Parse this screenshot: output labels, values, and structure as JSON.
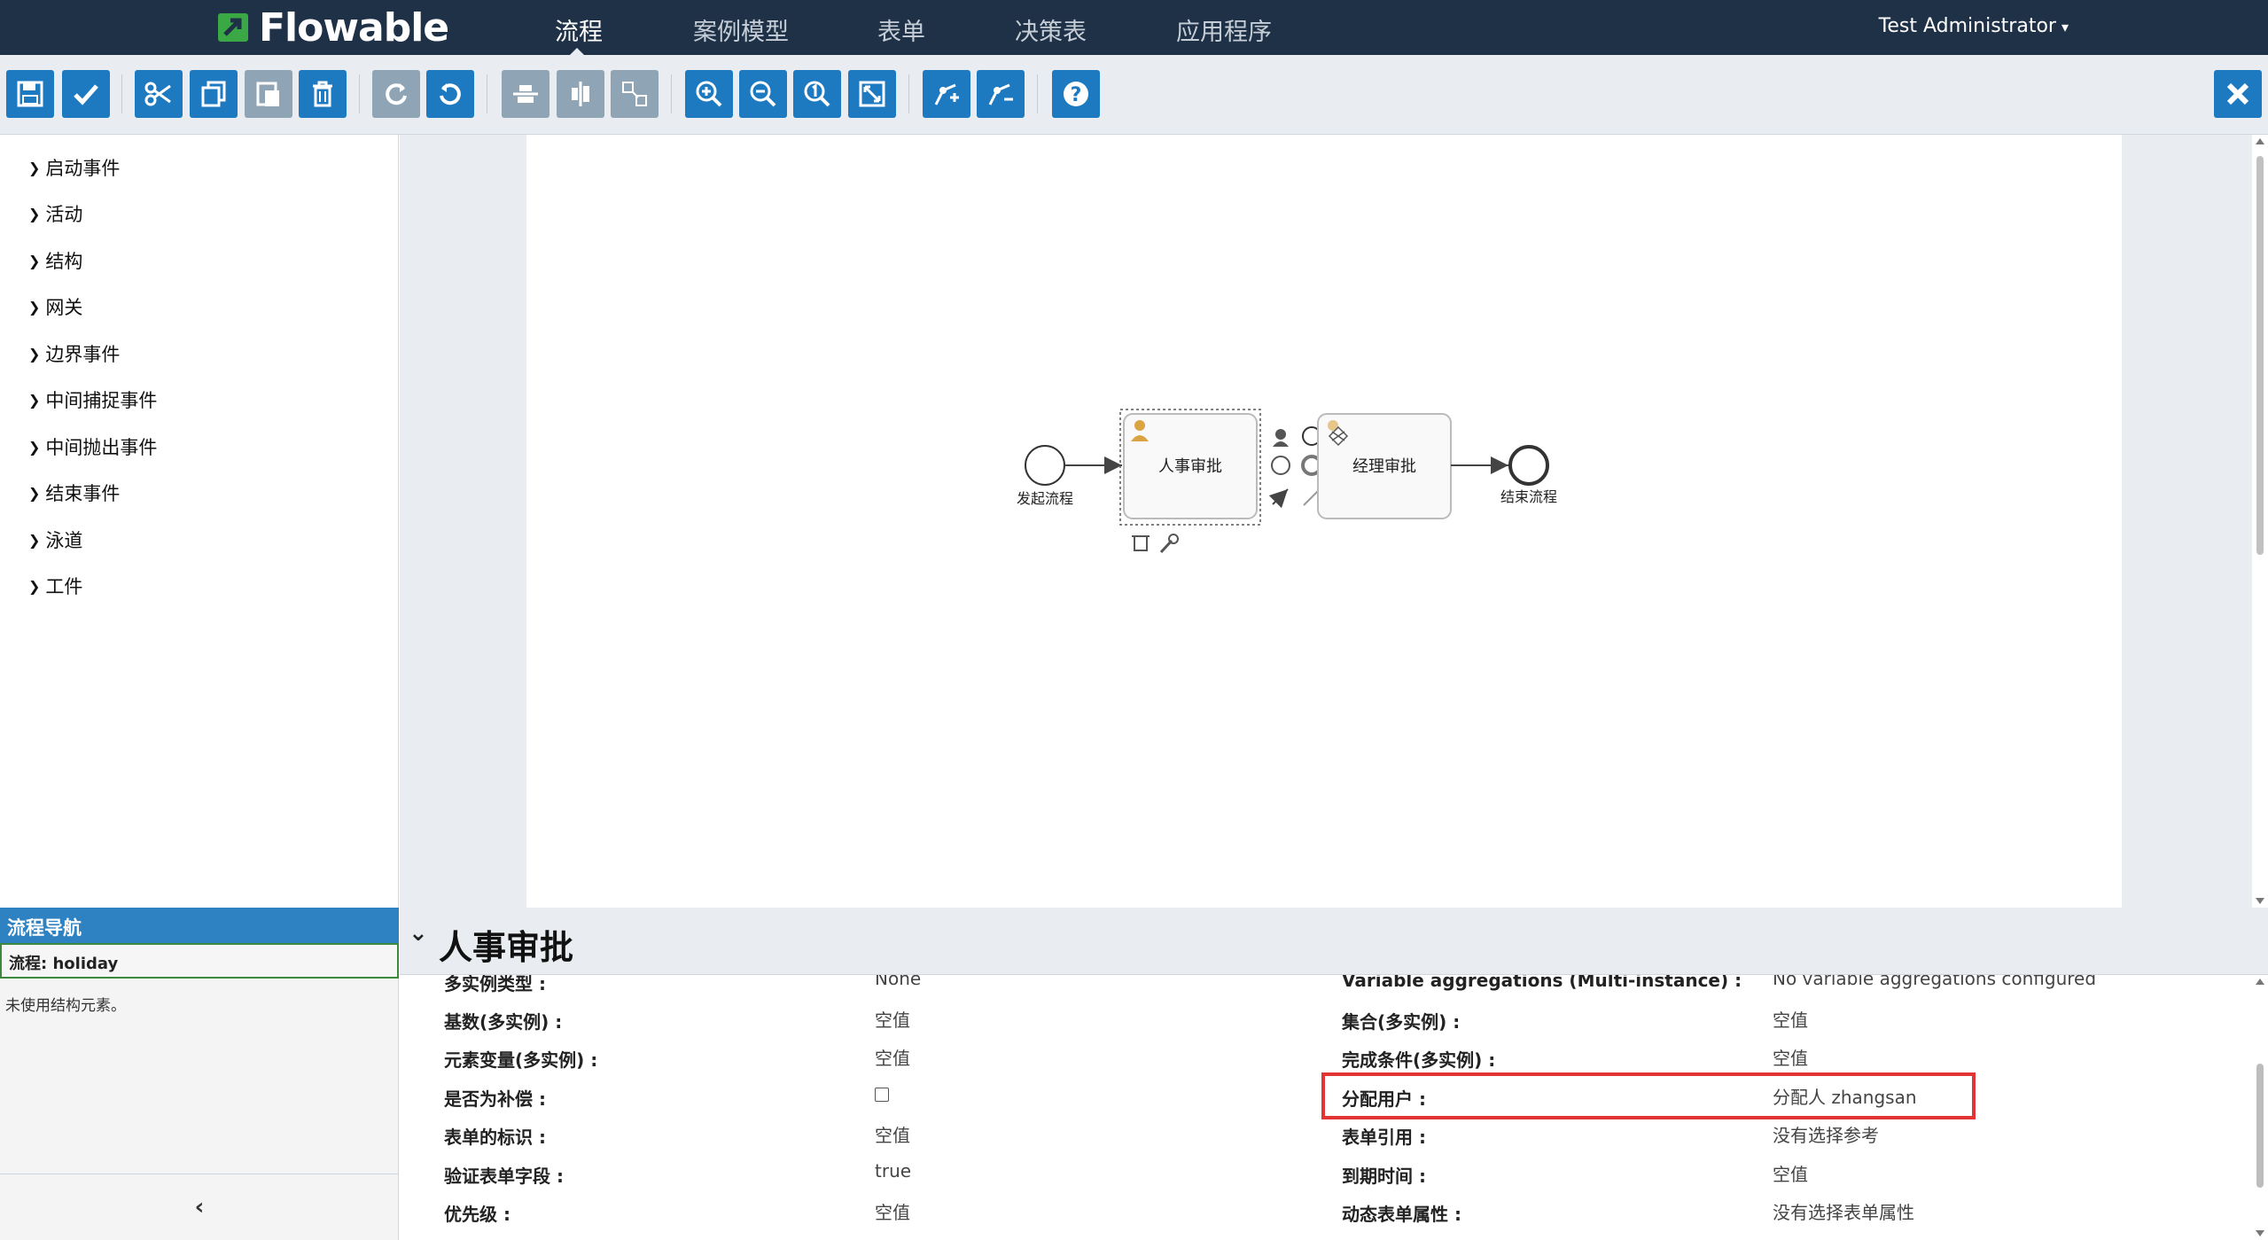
{
  "app": {
    "logo_text": "Flowable",
    "nav": [
      "流程",
      "案例模型",
      "表单",
      "决策表",
      "应用程序"
    ],
    "active_nav": "流程",
    "user": "Test Administrator"
  },
  "toolbar": {
    "buttons": [
      {
        "name": "save-button",
        "icon": "save-icon",
        "enabled": true
      },
      {
        "name": "validate-button",
        "icon": "check-icon",
        "enabled": true
      },
      {
        "name": "cut-button",
        "icon": "scissors-icon",
        "enabled": true
      },
      {
        "name": "copy-button",
        "icon": "copy-icon",
        "enabled": true
      },
      {
        "name": "paste-button",
        "icon": "paste-icon",
        "enabled": false
      },
      {
        "name": "delete-button",
        "icon": "trash-icon",
        "enabled": true
      },
      {
        "name": "redo-button",
        "icon": "redo-icon",
        "enabled": false
      },
      {
        "name": "undo-button",
        "icon": "undo-icon",
        "enabled": true
      },
      {
        "name": "align-horizontal-button",
        "icon": "align-horizontal-icon",
        "enabled": false
      },
      {
        "name": "align-vertical-button",
        "icon": "align-vertical-icon",
        "enabled": false
      },
      {
        "name": "same-size-button",
        "icon": "same-size-icon",
        "enabled": false
      },
      {
        "name": "zoom-in-button",
        "icon": "zoom-in-icon",
        "enabled": true
      },
      {
        "name": "zoom-out-button",
        "icon": "zoom-out-icon",
        "enabled": true
      },
      {
        "name": "zoom-actual-button",
        "icon": "zoom-actual-icon",
        "enabled": true
      },
      {
        "name": "zoom-fit-button",
        "icon": "fit-screen-icon",
        "enabled": true
      },
      {
        "name": "add-bendpoint-button",
        "icon": "add-bendpoint-icon",
        "enabled": true
      },
      {
        "name": "remove-bendpoint-button",
        "icon": "remove-bendpoint-icon",
        "enabled": true
      },
      {
        "name": "help-button",
        "icon": "help-icon",
        "enabled": true
      },
      {
        "name": "close-button",
        "icon": "close-icon",
        "enabled": true
      }
    ]
  },
  "palette": {
    "groups": [
      "启动事件",
      "活动",
      "结构",
      "网关",
      "边界事件",
      "中间捕捉事件",
      "中间抛出事件",
      "结束事件",
      "泳道",
      "工件"
    ]
  },
  "diagram": {
    "start_label": "发起流程",
    "task1_label": "人事审批",
    "task2_label": "经理审批",
    "end_label": "结束流程"
  },
  "navigator": {
    "title": "流程导航",
    "process": "流程: holiday",
    "note": "未使用结构元素。"
  },
  "properties": {
    "title": "人事审批",
    "left": [
      {
        "label": "多实例类型 :",
        "value": "None"
      },
      {
        "label": "基数(多实例) :",
        "value": "空值"
      },
      {
        "label": "元素变量(多实例) :",
        "value": "空值"
      },
      {
        "label": "是否为补偿 :",
        "value": ""
      },
      {
        "label": "表单的标识 :",
        "value": "空值"
      },
      {
        "label": "验证表单字段 :",
        "value": "true"
      },
      {
        "label": "优先级 :",
        "value": "空值"
      }
    ],
    "right": [
      {
        "label": "Variable aggregations (Multi-instance) :",
        "value": "No variable aggregations configured"
      },
      {
        "label": "集合(多实例) :",
        "value": "空值"
      },
      {
        "label": "完成条件(多实例) :",
        "value": "空值"
      },
      {
        "label": "分配用户 :",
        "value": "分配人 zhangsan"
      },
      {
        "label": "表单引用 :",
        "value": "没有选择参考"
      },
      {
        "label": "到期时间 :",
        "value": "空值"
      },
      {
        "label": "动态表单属性 :",
        "value": "没有选择表单属性"
      }
    ],
    "highlight_color": "#e23434"
  },
  "colors": {
    "navbar": "#1f3147",
    "button": "#1d7ac1",
    "button_disabled": "#8fa5b6",
    "navigator_header": "#2e82c1",
    "task_icon": "#d9a441"
  }
}
